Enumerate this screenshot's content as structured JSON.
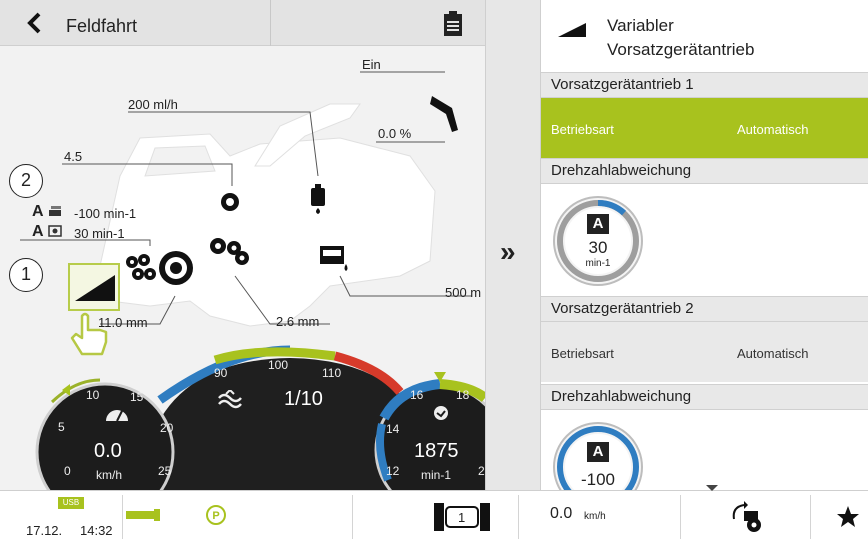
{
  "header": {
    "title": "Feldfahrt"
  },
  "diagram": {
    "label_ein": "Ein",
    "label_flow": "200 ml/h",
    "label_percent": "0.0 %",
    "label_height": "4.5",
    "label_a1": "-100 min-1",
    "label_a2": "30 min-1",
    "label_500": "500 m",
    "label_11mm": "11.0 mm",
    "label_26mm": "2.6 mm",
    "callout_2": "2",
    "callout_1": "1",
    "a_letter": "A"
  },
  "gauges": {
    "speed": {
      "ticks": [
        "10",
        "15",
        "5",
        "20",
        "0",
        "25"
      ],
      "value": "0.0",
      "unit": "km/h"
    },
    "middle": {
      "ticks": [
        "90",
        "100",
        "110"
      ],
      "value": "1/10"
    },
    "rpm": {
      "ticks": [
        "16",
        "18",
        "14",
        "12",
        "2"
      ],
      "value": "1875",
      "unit": "min-1"
    }
  },
  "right_panel": {
    "title_line1": "Variabler",
    "title_line2": "Vorsatzgerätantrieb",
    "section1": "Vorsatzgerätantrieb 1",
    "mode1": {
      "label": "Betriebsart",
      "value": "Automatisch"
    },
    "deviation1": "Drehzahlabweichung",
    "dial1": {
      "letter": "A",
      "value": "30",
      "unit": "min-1"
    },
    "section2": "Vorsatzgerätantrieb 2",
    "mode2": {
      "label": "Betriebsart",
      "value": "Automatisch"
    },
    "deviation2": "Drehzahlabweichung",
    "dial2": {
      "letter": "A",
      "value": "-100"
    }
  },
  "bottom_bar": {
    "usb": "USB",
    "date": "17.12.",
    "time": "14:32",
    "gear": "1",
    "speed_value": "0.0",
    "speed_unit": "km/h"
  },
  "colors": {
    "accent_green": "#a8c21e",
    "gauge_blue": "#2f7dc1",
    "gauge_red": "#d63a2a",
    "panel_grey": "#e8e8e8"
  }
}
